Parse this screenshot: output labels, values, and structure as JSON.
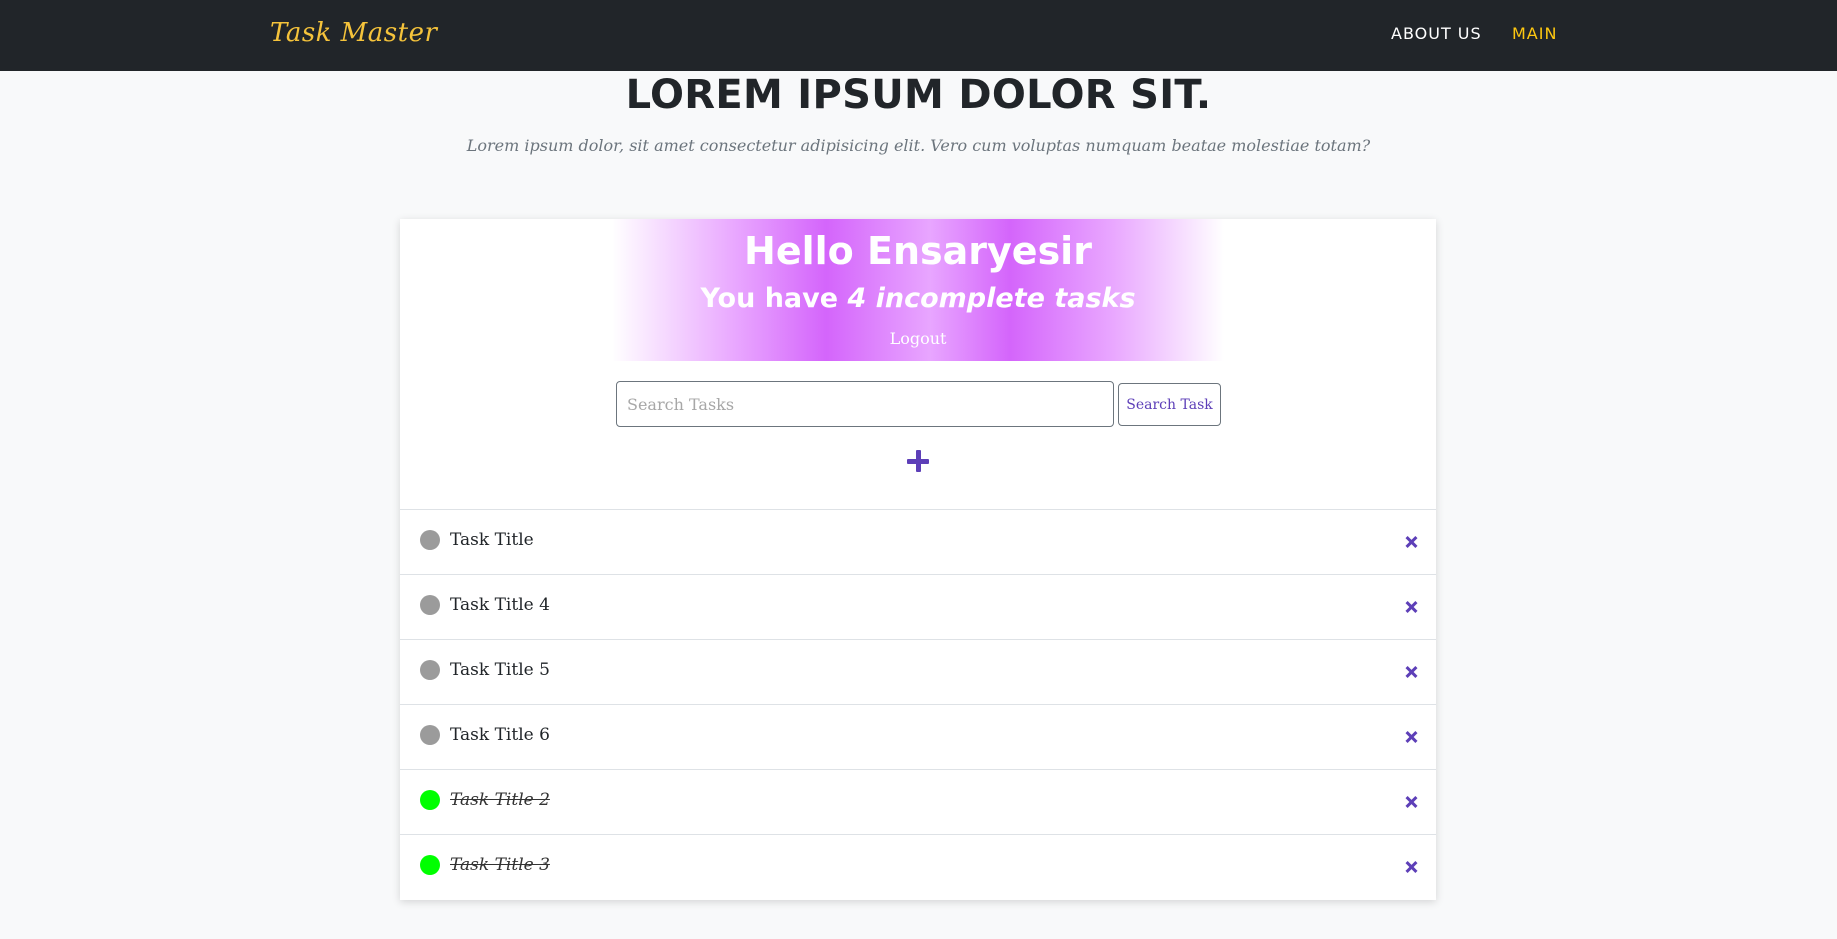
{
  "navbar": {
    "brand": "Task Master",
    "links": [
      {
        "label": "ABOUT US",
        "color": "#ffffff"
      },
      {
        "label": "MAIN",
        "color": "#fec810"
      }
    ]
  },
  "hero": {
    "title": "LOREM IPSUM DOLOR SIT.",
    "subtitle": "Lorem ipsum dolor, sit amet consectetur adipisicing elit. Vero cum voluptas numquam beatae molestiae totam?"
  },
  "greeting": {
    "hello": "Hello Ensaryesir",
    "count_prefix": "You have ",
    "count_emphasis": "4 incomplete tasks",
    "logout": "Logout"
  },
  "search": {
    "placeholder": "Search Tasks",
    "value": "",
    "button_label": "Search Task"
  },
  "add_icon": "plus-icon",
  "tasks": [
    {
      "title": "Task Title",
      "completed": false
    },
    {
      "title": "Task Title 4",
      "completed": false
    },
    {
      "title": "Task Title 5",
      "completed": false
    },
    {
      "title": "Task Title 6",
      "completed": false
    },
    {
      "title": "Task Title 2",
      "completed": true
    },
    {
      "title": "Task Title 3",
      "completed": true
    }
  ],
  "colors": {
    "navbar_bg": "#212529",
    "brand": "#f5c33b",
    "accent": "#5d3fb8",
    "greeting_bg": "#d465fb",
    "incomplete_dot": "#9b9b9b",
    "complete_dot": "#00ff00"
  }
}
